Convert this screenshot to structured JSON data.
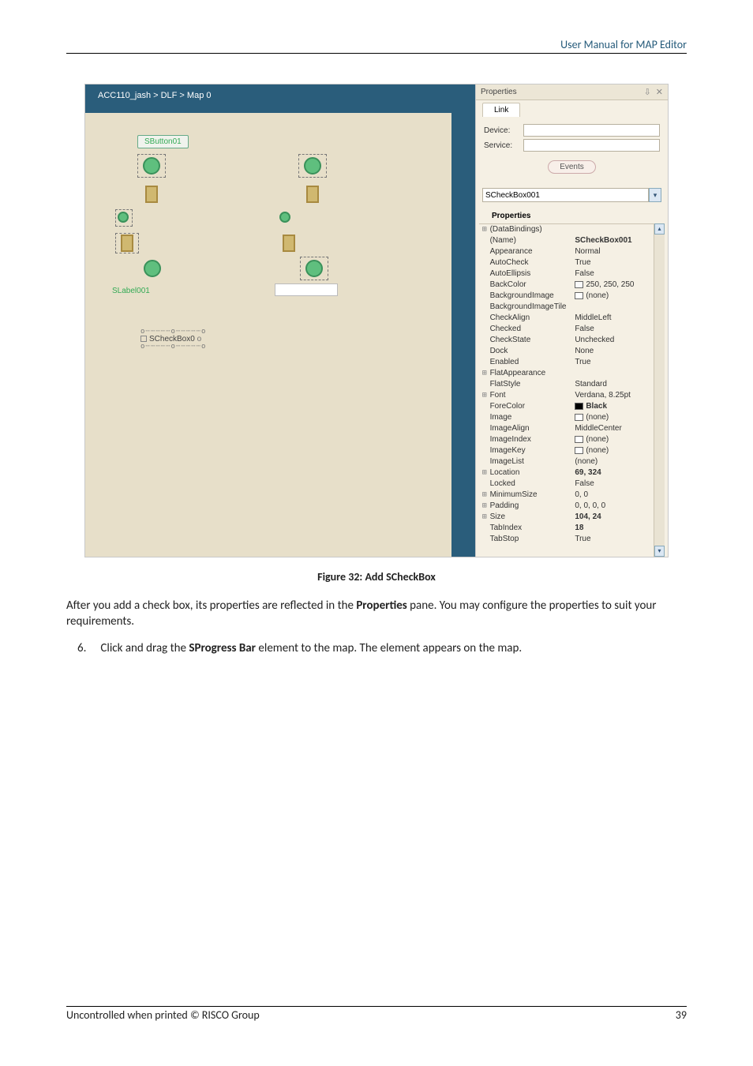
{
  "header": {
    "title": "User Manual for MAP Editor"
  },
  "figure": {
    "caption": "Figure 32: Add SCheckBox",
    "canvas": {
      "breadcrumb": "ACC110_jash > DLF > Map 0",
      "sbutton_label": "SButton01",
      "slabel_label": "SLabel001",
      "scheckbox_label": "SCheckBox0"
    },
    "panel": {
      "title": "Properties",
      "tab": "Link",
      "device_label": "Device:",
      "service_label": "Service:",
      "events_button": "Events",
      "combo_value": "SCheckBox001",
      "subhead": "Properties",
      "rows": [
        {
          "exp": "⊞",
          "k": "(DataBindings)",
          "v": ""
        },
        {
          "exp": "",
          "k": "(Name)",
          "v": "SCheckBox001",
          "bold": true
        },
        {
          "exp": "",
          "k": "Appearance",
          "v": "Normal"
        },
        {
          "exp": "",
          "k": "AutoCheck",
          "v": "True"
        },
        {
          "exp": "",
          "k": "AutoEllipsis",
          "v": "False"
        },
        {
          "exp": "",
          "k": "BackColor",
          "v": "250, 250, 250",
          "swatch": "#fafafa"
        },
        {
          "exp": "",
          "k": "BackgroundImage",
          "v": "(none)",
          "swatch": "#ffffff"
        },
        {
          "exp": "",
          "k": "BackgroundImageTile",
          "v": ""
        },
        {
          "exp": "",
          "k": "CheckAlign",
          "v": "MiddleLeft"
        },
        {
          "exp": "",
          "k": "Checked",
          "v": "False"
        },
        {
          "exp": "",
          "k": "CheckState",
          "v": "Unchecked"
        },
        {
          "exp": "",
          "k": "Dock",
          "v": "None"
        },
        {
          "exp": "",
          "k": "Enabled",
          "v": "True"
        },
        {
          "exp": "⊞",
          "k": "FlatAppearance",
          "v": ""
        },
        {
          "exp": "",
          "k": "FlatStyle",
          "v": "Standard"
        },
        {
          "exp": "⊞",
          "k": "Font",
          "v": "Verdana, 8.25pt"
        },
        {
          "exp": "",
          "k": "ForeColor",
          "v": "Black",
          "bold": true,
          "swatch": "#000000"
        },
        {
          "exp": "",
          "k": "Image",
          "v": "(none)",
          "swatch": "#ffffff"
        },
        {
          "exp": "",
          "k": "ImageAlign",
          "v": "MiddleCenter"
        },
        {
          "exp": "",
          "k": "ImageIndex",
          "v": "(none)",
          "swatch": "#ffffff"
        },
        {
          "exp": "",
          "k": "ImageKey",
          "v": "(none)",
          "swatch": "#ffffff"
        },
        {
          "exp": "",
          "k": "ImageList",
          "v": "(none)"
        },
        {
          "exp": "⊞",
          "k": "Location",
          "v": "69, 324",
          "bold": true
        },
        {
          "exp": "",
          "k": "Locked",
          "v": "False"
        },
        {
          "exp": "⊞",
          "k": "MinimumSize",
          "v": "0, 0"
        },
        {
          "exp": "⊞",
          "k": "Padding",
          "v": "0, 0, 0, 0"
        },
        {
          "exp": "⊞",
          "k": "Size",
          "v": "104, 24",
          "bold": true
        },
        {
          "exp": "",
          "k": "TabIndex",
          "v": "18",
          "bold": true
        },
        {
          "exp": "",
          "k": "TabStop",
          "v": "True"
        }
      ]
    }
  },
  "body": {
    "p1a": "After you add a check box, its properties are reflected in the ",
    "p1b": "Properties",
    "p1c": " pane. You may configure the properties to suit your requirements.",
    "step_num": "6.",
    "step_a": "Click and drag the ",
    "step_b": "SProgress Bar",
    "step_c": " element to the map. The element appears on the map."
  },
  "footer": {
    "left": "Uncontrolled when printed © RISCO Group",
    "right": "39"
  }
}
